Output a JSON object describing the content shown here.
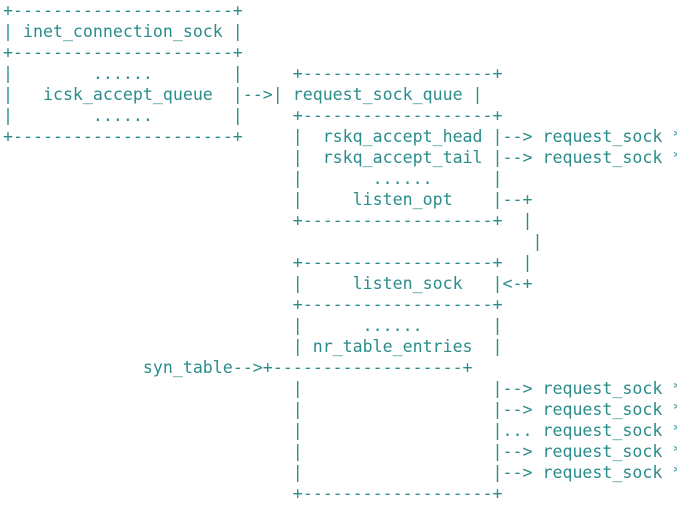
{
  "diagram": {
    "lines": [
      "+----------------------+",
      "| inet_connection_sock |",
      "+----------------------+",
      "|        ......        |     +-------------------+",
      "|   icsk_accept_queue  |-->| request_sock_quue |",
      "|        ......        |     +-------------------+",
      "+----------------------+     |  rskq_accept_head |--> request_sock *",
      "                             |  rskq_accept_tail |--> request_sock *",
      "                             |       ......      |",
      "                             |     listen_opt    |--+",
      "                             +-------------------+  |",
      "                                                     |",
      "                             +-------------------+  |",
      "                             |     listen_sock   |<-+",
      "                             +-------------------+",
      "                             |      ......       |",
      "                             | nr_table_entries  |",
      "              syn_table-->+-------------------+",
      "                             |                   |--> request_sock *",
      "                             |                   |--> request_sock *",
      "                             |                   |... request_sock *",
      "                             |                   |--> request_sock *",
      "                             |                   |--> request_sock *",
      "                             +-------------------+"
    ],
    "text_color": "#2b8c8c",
    "background": "#ffffff"
  }
}
